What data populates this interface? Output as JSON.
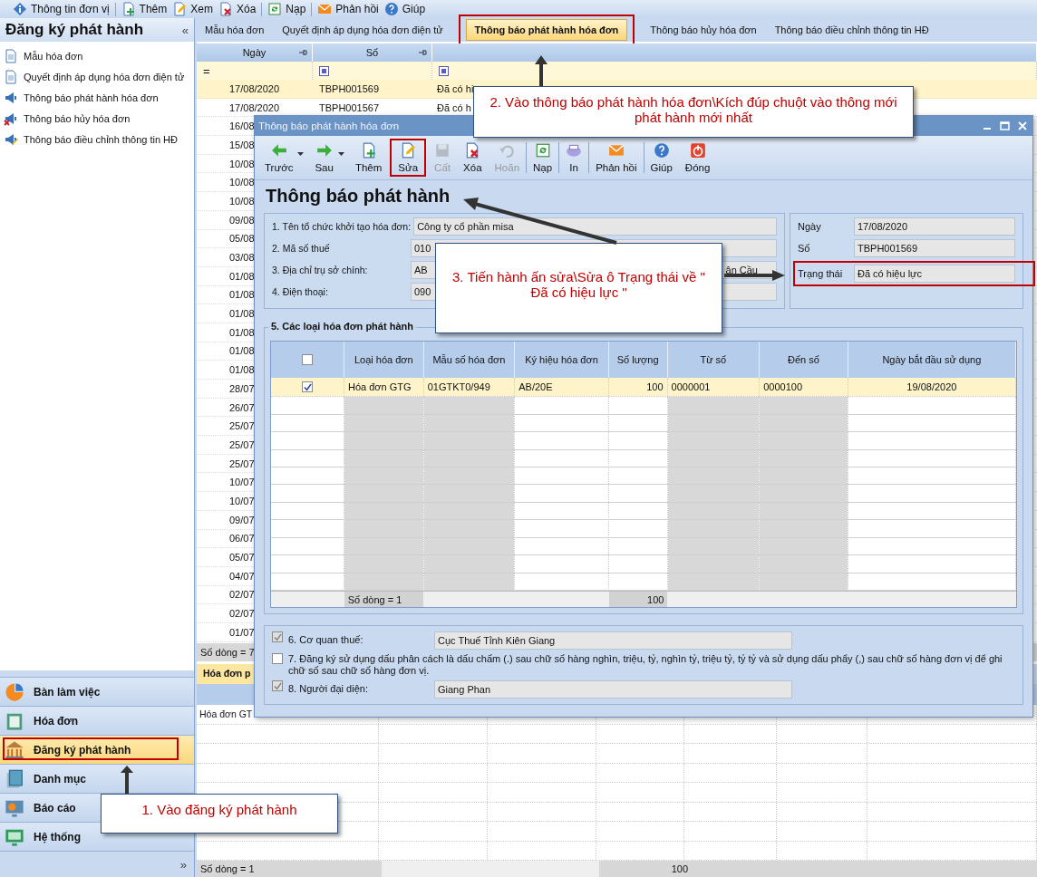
{
  "top_toolbar": [
    {
      "label": "Thông tin đơn vị",
      "separator": false
    },
    {
      "label": "Thêm",
      "separator": true
    },
    {
      "label": "Xem",
      "separator": false
    },
    {
      "label": "Xóa",
      "separator": false
    },
    {
      "label": "Nạp",
      "separator": true
    },
    {
      "label": "Phản hồi",
      "separator": true
    },
    {
      "label": "Giúp",
      "separator": false
    }
  ],
  "sidebar": {
    "title": "Đăng ký phát hành",
    "collapse_glyph": "«",
    "more_glyph": "»",
    "items": [
      "Mẫu hóa đơn",
      "Quyết định áp dụng hóa đơn điện tử",
      "Thông báo phát hành hóa đơn",
      "Thông báo hủy hóa đơn",
      "Thông báo điều chỉnh thông tin HĐ"
    ],
    "nav": [
      {
        "label": "Bàn làm việc",
        "selected": false
      },
      {
        "label": "Hóa đơn",
        "selected": false
      },
      {
        "label": "Đăng ký phát hành",
        "selected": true
      },
      {
        "label": "Danh mục",
        "selected": false
      },
      {
        "label": "Báo cáo",
        "selected": false
      },
      {
        "label": "Hệ thống",
        "selected": false
      }
    ]
  },
  "tabs": [
    {
      "label": "Mẫu hóa đơn",
      "selected": false
    },
    {
      "label": "Quyết định áp dụng hóa đơn điện tử",
      "selected": false
    },
    {
      "label": "Thông báo phát hành hóa đơn",
      "selected": true
    },
    {
      "label": "Thông báo hủy hóa đơn",
      "selected": false
    },
    {
      "label": "Thông báo điều chỉnh thông tin HĐ",
      "selected": false
    }
  ],
  "list": {
    "columns": [
      "Ngày",
      "Số"
    ],
    "filter_glyph": "=",
    "footer": "Số dòng = 7",
    "rows": [
      {
        "date": "17/08/2020",
        "number": "TBPH001569",
        "status": "Đã có hi",
        "selected": true
      },
      {
        "date": "17/08/2020",
        "number": "TBPH001567",
        "status": "Đã có h",
        "selected": false
      },
      {
        "date": "16/08",
        "selected": false
      },
      {
        "date": "15/08",
        "selected": false
      },
      {
        "date": "10/08",
        "selected": false
      },
      {
        "date": "10/08",
        "selected": false
      },
      {
        "date": "10/08",
        "selected": false
      },
      {
        "date": "09/08",
        "selected": false
      },
      {
        "date": "05/08",
        "selected": false
      },
      {
        "date": "03/08",
        "selected": false
      },
      {
        "date": "01/08",
        "selected": false
      },
      {
        "date": "01/08",
        "selected": false
      },
      {
        "date": "01/08",
        "selected": false
      },
      {
        "date": "01/08",
        "selected": false
      },
      {
        "date": "01/08",
        "selected": false
      },
      {
        "date": "01/08",
        "selected": false
      },
      {
        "date": "28/07",
        "selected": false
      },
      {
        "date": "26/07",
        "selected": false
      },
      {
        "date": "25/07",
        "selected": false
      },
      {
        "date": "25/07",
        "selected": false
      },
      {
        "date": "25/07",
        "selected": false
      },
      {
        "date": "10/07",
        "selected": false
      },
      {
        "date": "10/07",
        "selected": false
      },
      {
        "date": "09/07",
        "selected": false
      },
      {
        "date": "06/07",
        "selected": false
      },
      {
        "date": "05/07",
        "selected": false
      },
      {
        "date": "04/07",
        "selected": false
      },
      {
        "date": "02/07",
        "selected": false
      },
      {
        "date": "02/07",
        "selected": false
      },
      {
        "date": "01/07",
        "selected": false
      }
    ]
  },
  "detail": {
    "tab": "Hóa đơn p",
    "rows": [
      "Hóa đơn GT"
    ],
    "footer": "Số dòng = 1",
    "total": "100"
  },
  "dialog": {
    "title": "Thông báo phát hành hóa đơn",
    "heading": "Thông báo phát hành",
    "toolbar": [
      {
        "label": "Trước",
        "dropdown": true,
        "disabled": false,
        "separator": false
      },
      {
        "label": "Sau",
        "dropdown": true,
        "disabled": false,
        "separator": false
      },
      {
        "label": "Thêm",
        "dropdown": false,
        "disabled": false,
        "separator": false
      },
      {
        "label": "Sửa",
        "dropdown": false,
        "disabled": false,
        "separator": false
      },
      {
        "label": "Cất",
        "dropdown": false,
        "disabled": true,
        "separator": false
      },
      {
        "label": "Xóa",
        "dropdown": false,
        "disabled": false,
        "separator": false
      },
      {
        "label": "Hoãn",
        "dropdown": false,
        "disabled": true,
        "separator": false
      },
      {
        "label": "Nạp",
        "dropdown": false,
        "disabled": false,
        "separator": true
      },
      {
        "label": "In",
        "dropdown": false,
        "disabled": false,
        "separator": true
      },
      {
        "label": "Phản hồi",
        "dropdown": false,
        "disabled": false,
        "separator": true
      },
      {
        "label": "Giúp",
        "dropdown": false,
        "disabled": false,
        "separator": true
      },
      {
        "label": "Đóng",
        "dropdown": false,
        "disabled": false,
        "separator": false
      }
    ],
    "fields": [
      {
        "label": "1. Tên tổ chức khởi tạo hóa đơn:",
        "value_parts": [
          "Công ty cổ phần misa"
        ]
      },
      {
        "label": "2. Mã số thuế",
        "value_parts": [
          "010"
        ]
      },
      {
        "label": "3. Địa chỉ trụ sở chính:",
        "value_parts": [
          "AB",
          "ận Cầu"
        ]
      },
      {
        "label": "4. Điện thoại:",
        "value_parts": [
          "090"
        ]
      }
    ],
    "info": [
      {
        "label": "Ngày",
        "value": "17/08/2020"
      },
      {
        "label": "Số",
        "value": "TBPH001569"
      },
      {
        "label": "Trạng thái",
        "value": "Đã có hiệu lực"
      }
    ],
    "invoice_types": {
      "title": "5. Các loại hóa đơn phát hành",
      "select_all": false,
      "columns": [
        {
          "label": "Loại hóa đơn",
          "disabled": true
        },
        {
          "label": "Mẫu số hóa đơn",
          "disabled": true
        },
        {
          "label": "Ký hiệu hóa đơn",
          "disabled": false
        },
        {
          "label": "Số lượng",
          "disabled": false
        },
        {
          "label": "Từ số",
          "disabled": true
        },
        {
          "label": "Đến số",
          "disabled": true
        },
        {
          "label": "Ngày bắt đầu sử dụng",
          "disabled": false
        }
      ],
      "rows": [
        {
          "checked": true,
          "cells": [
            "Hóa đơn GTG",
            "01GTKT0/949",
            "AB/20E",
            "100",
            "0000001",
            "0000100",
            "19/08/2020"
          ]
        }
      ],
      "footer_count": "Số dòng = 1",
      "footer_total": "100"
    },
    "options": [
      {
        "checked": true,
        "disabled": true,
        "label": "6. Cơ quan thuế:",
        "value": "Cục Thuế Tỉnh Kiên Giang"
      },
      {
        "checked": false,
        "disabled": false,
        "label": "7. Đăng ký sử dụng dấu phân cách là dấu chấm (.) sau chữ số hàng nghìn, triệu, tỷ, nghìn tỷ, triệu tỷ, tỷ tỷ và sử dụng dấu phẩy (,) sau chữ số hàng đơn vị để ghi chữ số sau chữ số hàng đơn vị."
      },
      {
        "checked": true,
        "disabled": true,
        "label": "8. Người đại diện:",
        "value": "Giang Phan"
      }
    ]
  },
  "callouts": [
    {
      "text": "2. Vào thông báo phát hành hóa đơn\\Kích đúp chuột vào thông mới phát hành mới nhất"
    },
    {
      "text": "3. Tiến hành ấn sửa\\Sửa ô Trạng thái về \" Đã có hiệu lực \""
    },
    {
      "text": "1. Vào đăng ký phát hành"
    }
  ]
}
